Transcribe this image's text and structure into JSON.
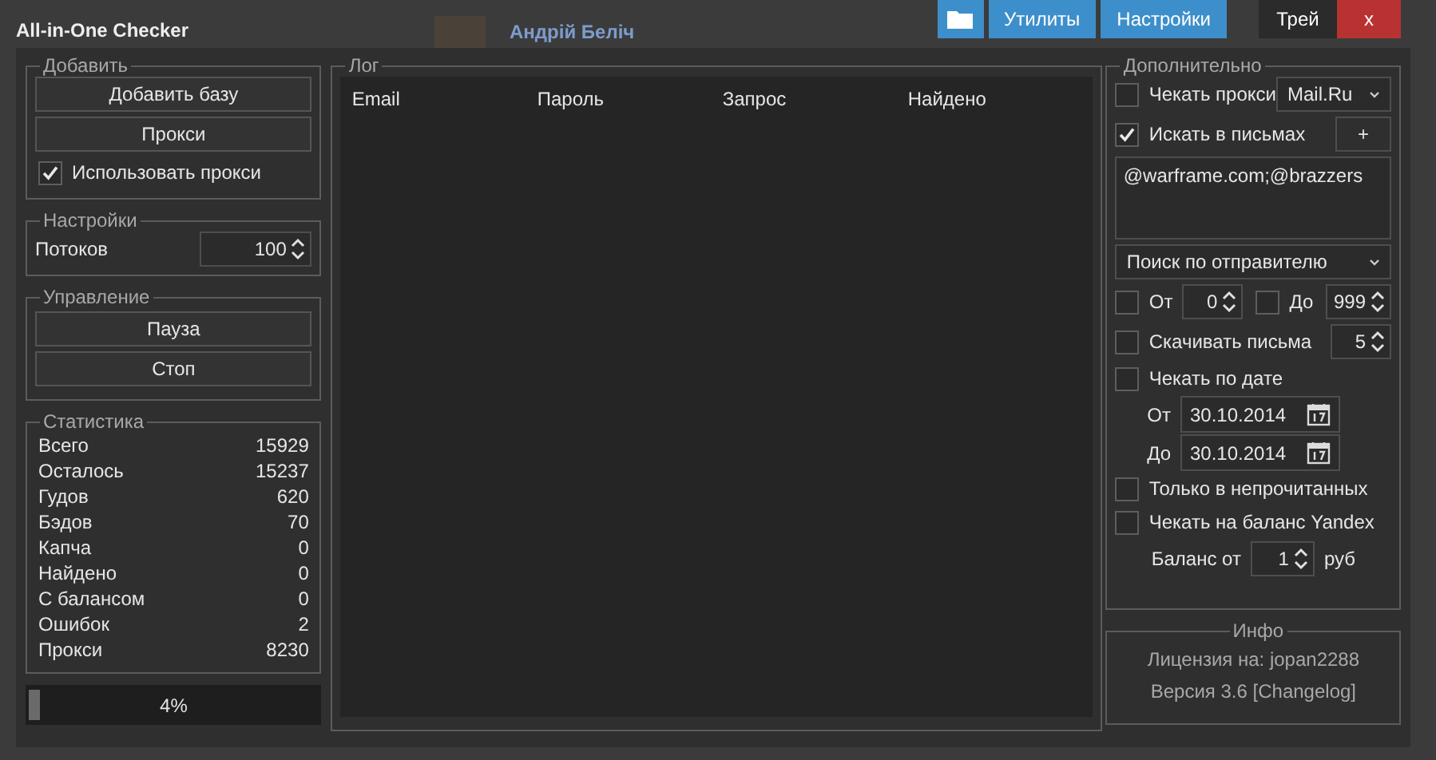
{
  "window": {
    "title": "All-in-One Checker"
  },
  "background": {
    "name": "Андрій Беліч"
  },
  "toolbar": [
    {
      "kind": "folder"
    },
    {
      "kind": "blue",
      "label": "Утилиты"
    },
    {
      "kind": "blue",
      "label": "Настройки"
    },
    {
      "kind": "tray",
      "label": "Трей"
    },
    {
      "kind": "close",
      "label": "x"
    }
  ],
  "add": {
    "title": "Добавить",
    "buttons": [
      "Добавить базу",
      "Прокси"
    ],
    "use_proxy": {
      "label": "Использовать прокси",
      "checked": true
    }
  },
  "settings": {
    "title": "Настройки",
    "threads": {
      "label": "Потоков",
      "value": "100"
    }
  },
  "control": {
    "title": "Управление",
    "buttons": [
      "Пауза",
      "Стоп"
    ]
  },
  "stats": {
    "title": "Статистика",
    "rows": [
      {
        "label": "Всего",
        "value": "15929"
      },
      {
        "label": "Осталось",
        "value": "15237"
      },
      {
        "label": "Гудов",
        "value": "620"
      },
      {
        "label": "Бэдов",
        "value": "70"
      },
      {
        "label": "Капча",
        "value": "0"
      },
      {
        "label": "Найдено",
        "value": "0"
      },
      {
        "label": "С балансом",
        "value": "0"
      },
      {
        "label": "Ошибок",
        "value": "2"
      },
      {
        "label": "Прокси",
        "value": "8230"
      }
    ]
  },
  "progress": {
    "level": 0.04,
    "reading": "4%"
  },
  "log": {
    "title": "Лог",
    "columns": [
      "Email",
      "Пароль",
      "Запрос",
      "Найдено"
    ]
  },
  "extra": {
    "title": "Дополнительно",
    "check_proxy": {
      "label": "Чекать прокси",
      "checked": false,
      "service": "Mail.Ru"
    },
    "search_mail": {
      "label": "Искать в письмах",
      "checked": true,
      "add_button": "+"
    },
    "query": "@warframe.com;@brazzers",
    "search_mode": "Поиск по отправителю",
    "from": {
      "label": "От",
      "checked": false,
      "value": "0"
    },
    "to": {
      "label": "До",
      "checked": false,
      "value": "999"
    },
    "download": {
      "label": "Скачивать письма",
      "checked": false,
      "value": "5"
    },
    "by_date": {
      "label": "Чекать по дате",
      "checked": false
    },
    "date_from": {
      "label": "От",
      "value": "30.10.2014"
    },
    "date_to": {
      "label": "До",
      "value": "30.10.2014"
    },
    "unread": {
      "label": "Только в непрочитанных",
      "checked": false
    },
    "yandex": {
      "label": "Чекать на баланс Yandex",
      "checked": false
    },
    "balance": {
      "label": "Баланс от",
      "value": "1",
      "unit": "руб"
    }
  },
  "info": {
    "title": "Инфо",
    "license": "Лицензия на: jopan2288",
    "version": "Версия 3.6 [Changelog]"
  }
}
